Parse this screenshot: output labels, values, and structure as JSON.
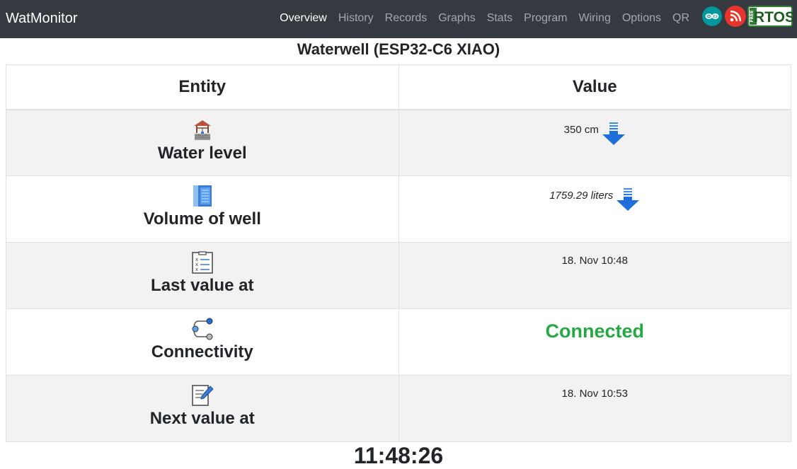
{
  "navbar": {
    "brand": "WatMonitor",
    "items": [
      {
        "label": "Overview"
      },
      {
        "label": "History"
      },
      {
        "label": "Records"
      },
      {
        "label": "Graphs"
      },
      {
        "label": "Stats"
      },
      {
        "label": "Program"
      },
      {
        "label": "Wiring"
      },
      {
        "label": "Options"
      },
      {
        "label": "QR"
      }
    ],
    "logos": {
      "rtos_text": "RTOS",
      "free_text": "FREE"
    }
  },
  "main": {
    "title": "Waterwell (ESP32-C6 XIAO)",
    "table": {
      "headers": [
        "Entity",
        "Value"
      ],
      "rows": [
        {
          "entity": "Water level",
          "icon": "well-icon",
          "value": "350 cm",
          "indicator": "down-arrow-icon"
        },
        {
          "entity": "Volume of well",
          "icon": "notebook-icon",
          "value": "1759.29 liters",
          "indicator": "down-arrow-icon"
        },
        {
          "entity": "Last value at",
          "icon": "checklist-icon",
          "value": "18. Nov 10:48"
        },
        {
          "entity": "Connectivity",
          "icon": "connection-icon",
          "value": "Connected",
          "value_color": "#28a745"
        },
        {
          "entity": "Next value at",
          "icon": "edit-document-icon",
          "value": "18. Nov 10:53"
        }
      ]
    },
    "clock": "11:48:26"
  },
  "colors": {
    "navbar_bg": "#343a40",
    "status_ok": "#28a745",
    "arrow_blue": "#1e6fd9",
    "stripe": "#f2f2f2"
  }
}
